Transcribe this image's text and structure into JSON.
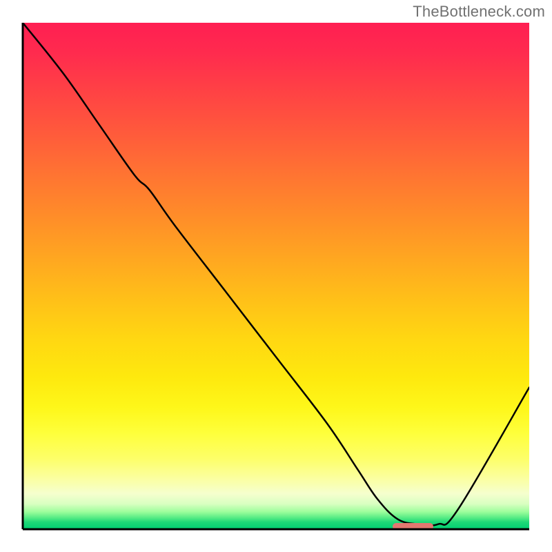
{
  "watermark": "TheBottleneck.com",
  "colors": {
    "gradient_top": "#ff1f52",
    "gradient_mid": "#ffcf14",
    "gradient_bottom": "#00cf72",
    "curve": "#000000",
    "axis": "#000000",
    "marker": "#e27870"
  },
  "chart_data": {
    "type": "line",
    "title": "",
    "xlabel": "",
    "ylabel": "",
    "xlim": [
      0,
      100
    ],
    "ylim": [
      0,
      100
    ],
    "x": [
      0,
      8,
      15,
      22,
      25,
      30,
      40,
      50,
      60,
      66,
      70,
      74,
      78,
      82,
      86,
      100
    ],
    "y": [
      100,
      90,
      80,
      70,
      67,
      60,
      47,
      34,
      21,
      12,
      6,
      2,
      1,
      1,
      4,
      28
    ],
    "marker": {
      "x_start": 73,
      "x_end": 81,
      "y": 0.6
    },
    "background": "vertical-gradient",
    "grid": false,
    "legend": false
  }
}
